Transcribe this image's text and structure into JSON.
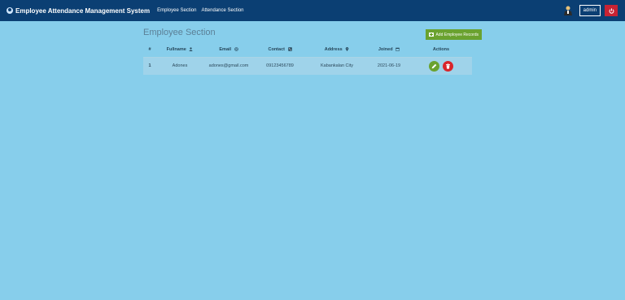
{
  "navbar": {
    "brand": "Employee Attendance Management System",
    "links": [
      "Employee Section",
      "Attendance Section"
    ],
    "admin_label": "admin"
  },
  "section": {
    "title": "Employee Section",
    "add_button": "Add Employee Records"
  },
  "table": {
    "headers": [
      "#",
      "Fullname",
      "Email",
      "Contact",
      "Address",
      "Joined",
      "Actions"
    ],
    "rows": [
      {
        "num": "1",
        "fullname": "Adones",
        "email": "adones@gmail.com",
        "contact": "09123456789",
        "address": "Kabankalan City",
        "joined": "2021-06-19"
      }
    ]
  },
  "colors": {
    "navbar": "#0b3f73",
    "background": "#87ceeb",
    "add_button": "#6aa22f",
    "delete": "#d9252b",
    "power": "#c82333"
  },
  "icons": [
    "user-icon",
    "email-at-icon",
    "phone-square-icon",
    "map-marker-icon",
    "calendar-icon",
    "pencil-icon",
    "trash-icon",
    "power-icon",
    "plus-square-icon",
    "person-avatar-icon"
  ]
}
